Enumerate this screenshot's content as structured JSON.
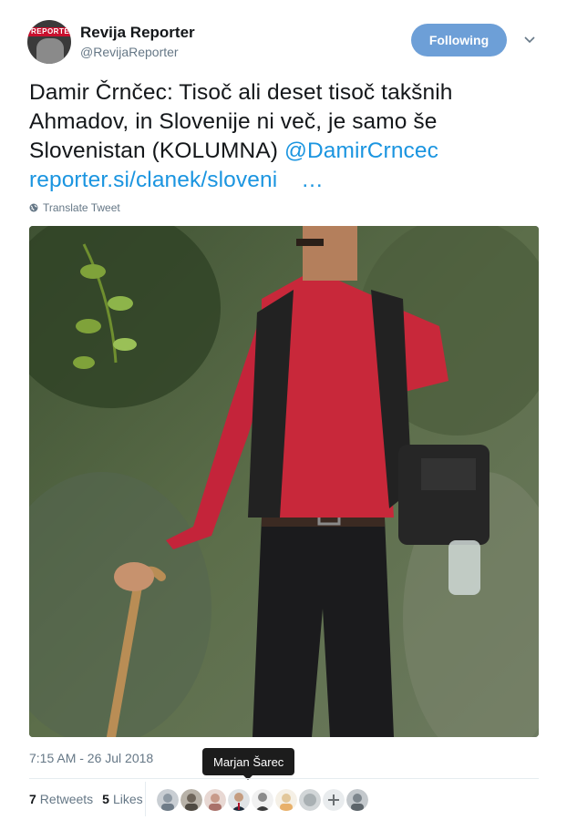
{
  "account": {
    "display_name": "Revija Reporter",
    "handle": "@RevijaReporter",
    "avatar_logo_text": "REPORTER"
  },
  "follow_button": {
    "label": "Following"
  },
  "tweet": {
    "text": "Damir Črnčec: Tisoč ali deset tisoč takšnih Ahmadov, in Slovenije ni več, je samo še Slovenistan (KOLUMNA) ",
    "mention": "@DamirCrncec",
    "link": "reporter.si/clanek/sloveni",
    "link_ellipsis": "…",
    "translate_label": "Translate Tweet"
  },
  "meta": {
    "timestamp": "7:15 AM - 26 Jul 2018"
  },
  "tooltip": {
    "text": "Marjan Šarec"
  },
  "stats": {
    "retweets_count": "7",
    "retweets_label": "Retweets",
    "likes_count": "5",
    "likes_label": "Likes"
  },
  "likers": [
    {
      "name": "liker-1"
    },
    {
      "name": "liker-2"
    },
    {
      "name": "liker-3"
    },
    {
      "name": "liker-4"
    },
    {
      "name": "liker-5"
    },
    {
      "name": "liker-6"
    },
    {
      "name": "liker-7"
    },
    {
      "name": "liker-8"
    },
    {
      "name": "liker-9"
    }
  ],
  "colors": {
    "link": "#1b95e0",
    "follow_button": "#6d9fd7",
    "muted": "#657786",
    "text": "#14171a"
  },
  "icons": [
    "chevron-down-icon",
    "globe-icon"
  ]
}
